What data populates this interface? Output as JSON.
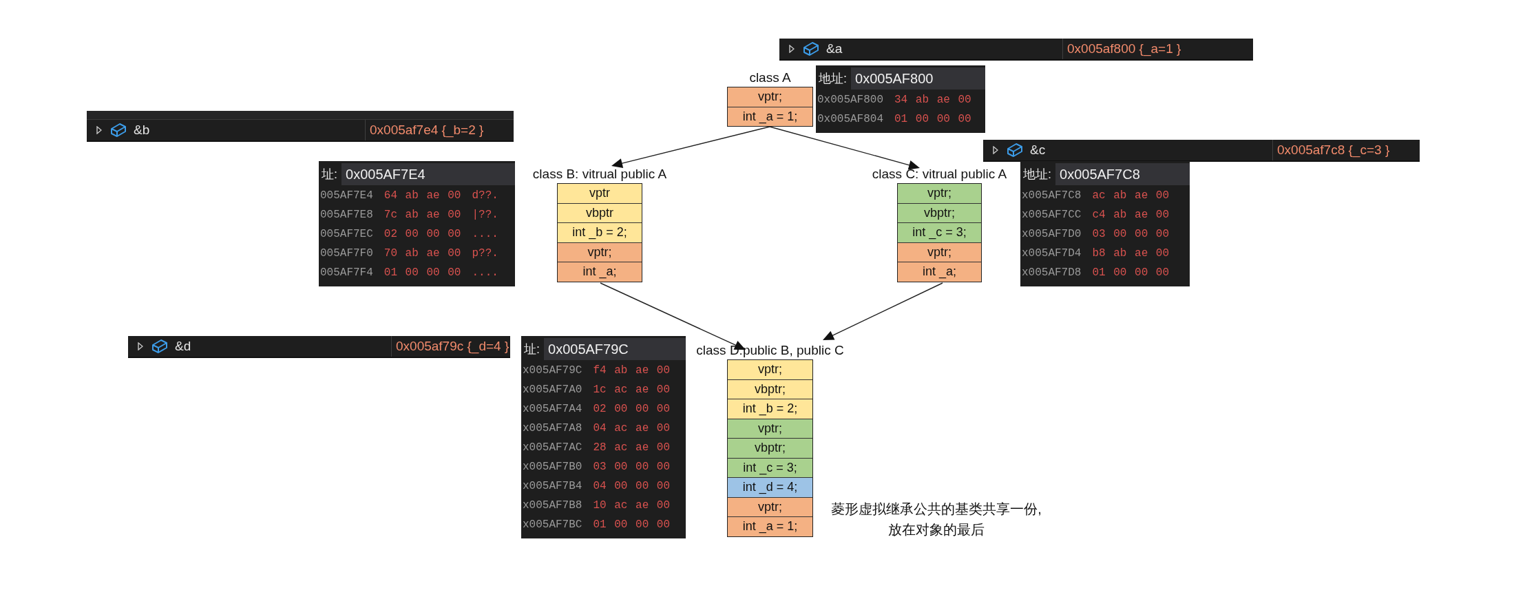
{
  "watches": [
    {
      "name": "&a",
      "value": "0x005af800 {_a=1 }",
      "header": false
    },
    {
      "name": "&b",
      "value": "0x005af7e4 {_b=2 }",
      "header": true
    },
    {
      "name": "&c",
      "value": "0x005af7c8 {_c=3 }",
      "header": false
    },
    {
      "name": "&d",
      "value": "0x005af79c {_d=4 }",
      "header": false
    }
  ],
  "memory_views": [
    {
      "label": "地址:",
      "address": "0x005AF800",
      "rows": [
        {
          "address": "0x005AF800",
          "bytes": "34 ab ae 00"
        },
        {
          "address": "0x005AF804",
          "bytes": "01 00 00 00"
        }
      ]
    },
    {
      "label": "址:",
      "address": "0x005AF7E4",
      "rows": [
        {
          "address": "005AF7E4",
          "bytes": "64 ab ae 00",
          "ascii": "d??."
        },
        {
          "address": "005AF7E8",
          "bytes": "7c ab ae 00",
          "ascii": "|??."
        },
        {
          "address": "005AF7EC",
          "bytes": "02 00 00 00",
          "ascii": "...."
        },
        {
          "address": "005AF7F0",
          "bytes": "70 ab ae 00",
          "ascii": "p??."
        },
        {
          "address": "005AF7F4",
          "bytes": "01 00 00 00",
          "ascii": "...."
        }
      ]
    },
    {
      "label": "地址:",
      "address": "0x005AF7C8",
      "rows": [
        {
          "address": "x005AF7C8",
          "bytes": "ac ab ae 00"
        },
        {
          "address": "x005AF7CC",
          "bytes": "c4 ab ae 00"
        },
        {
          "address": "x005AF7D0",
          "bytes": "03 00 00 00"
        },
        {
          "address": "x005AF7D4",
          "bytes": "b8 ab ae 00"
        },
        {
          "address": "x005AF7D8",
          "bytes": "01 00 00 00"
        }
      ]
    },
    {
      "label": "址:",
      "address": "0x005AF79C",
      "rows": [
        {
          "address": "x005AF79C",
          "bytes": "f4 ab ae 00"
        },
        {
          "address": "x005AF7A0",
          "bytes": "1c ac ae 00"
        },
        {
          "address": "x005AF7A4",
          "bytes": "02 00 00 00"
        },
        {
          "address": "x005AF7A8",
          "bytes": "04 ac ae 00"
        },
        {
          "address": "x005AF7AC",
          "bytes": "28 ac ae 00"
        },
        {
          "address": "x005AF7B0",
          "bytes": "03 00 00 00"
        },
        {
          "address": "x005AF7B4",
          "bytes": "04 00 00 00"
        },
        {
          "address": "x005AF7B8",
          "bytes": "10 ac ae 00"
        },
        {
          "address": "x005AF7BC",
          "bytes": "01 00 00 00"
        }
      ]
    }
  ],
  "classes": [
    {
      "title": "class A",
      "fields": [
        {
          "text": "vptr;",
          "color": "#f4b183"
        },
        {
          "text": "int _a = 1;",
          "color": "#f4b183"
        }
      ]
    },
    {
      "title": "class B: vitrual public A",
      "fields": [
        {
          "text": "vptr",
          "color": "#ffe699"
        },
        {
          "text": "vbptr",
          "color": "#ffe699"
        },
        {
          "text": "int _b = 2;",
          "color": "#ffe699"
        },
        {
          "text": "vptr;",
          "color": "#f4b183"
        },
        {
          "text": "int _a;",
          "color": "#f4b183"
        }
      ]
    },
    {
      "title": "class C: vitrual public A",
      "fields": [
        {
          "text": "vptr;",
          "color": "#a9d18e"
        },
        {
          "text": "vbptr;",
          "color": "#a9d18e"
        },
        {
          "text": "int _c = 3;",
          "color": "#a9d18e"
        },
        {
          "text": "vptr;",
          "color": "#f4b183"
        },
        {
          "text": "int _a;",
          "color": "#f4b183"
        }
      ]
    },
    {
      "title": "class D:public B, public C",
      "fields": [
        {
          "text": "vptr;",
          "color": "#ffe699"
        },
        {
          "text": "vbptr;",
          "color": "#ffe699"
        },
        {
          "text": "int _b = 2;",
          "color": "#ffe699"
        },
        {
          "text": "vptr;",
          "color": "#a9d18e"
        },
        {
          "text": "vbptr;",
          "color": "#a9d18e"
        },
        {
          "text": "int _c = 3;",
          "color": "#a9d18e"
        },
        {
          "text": "int _d = 4;",
          "color": "#9dc3e6"
        },
        {
          "text": "vptr;",
          "color": "#f4b183"
        },
        {
          "text": "int _a = 1;",
          "color": "#f4b183"
        }
      ]
    }
  ],
  "note": "菱形虚拟继承公共的基类共享一份,\n放在对象的最后"
}
